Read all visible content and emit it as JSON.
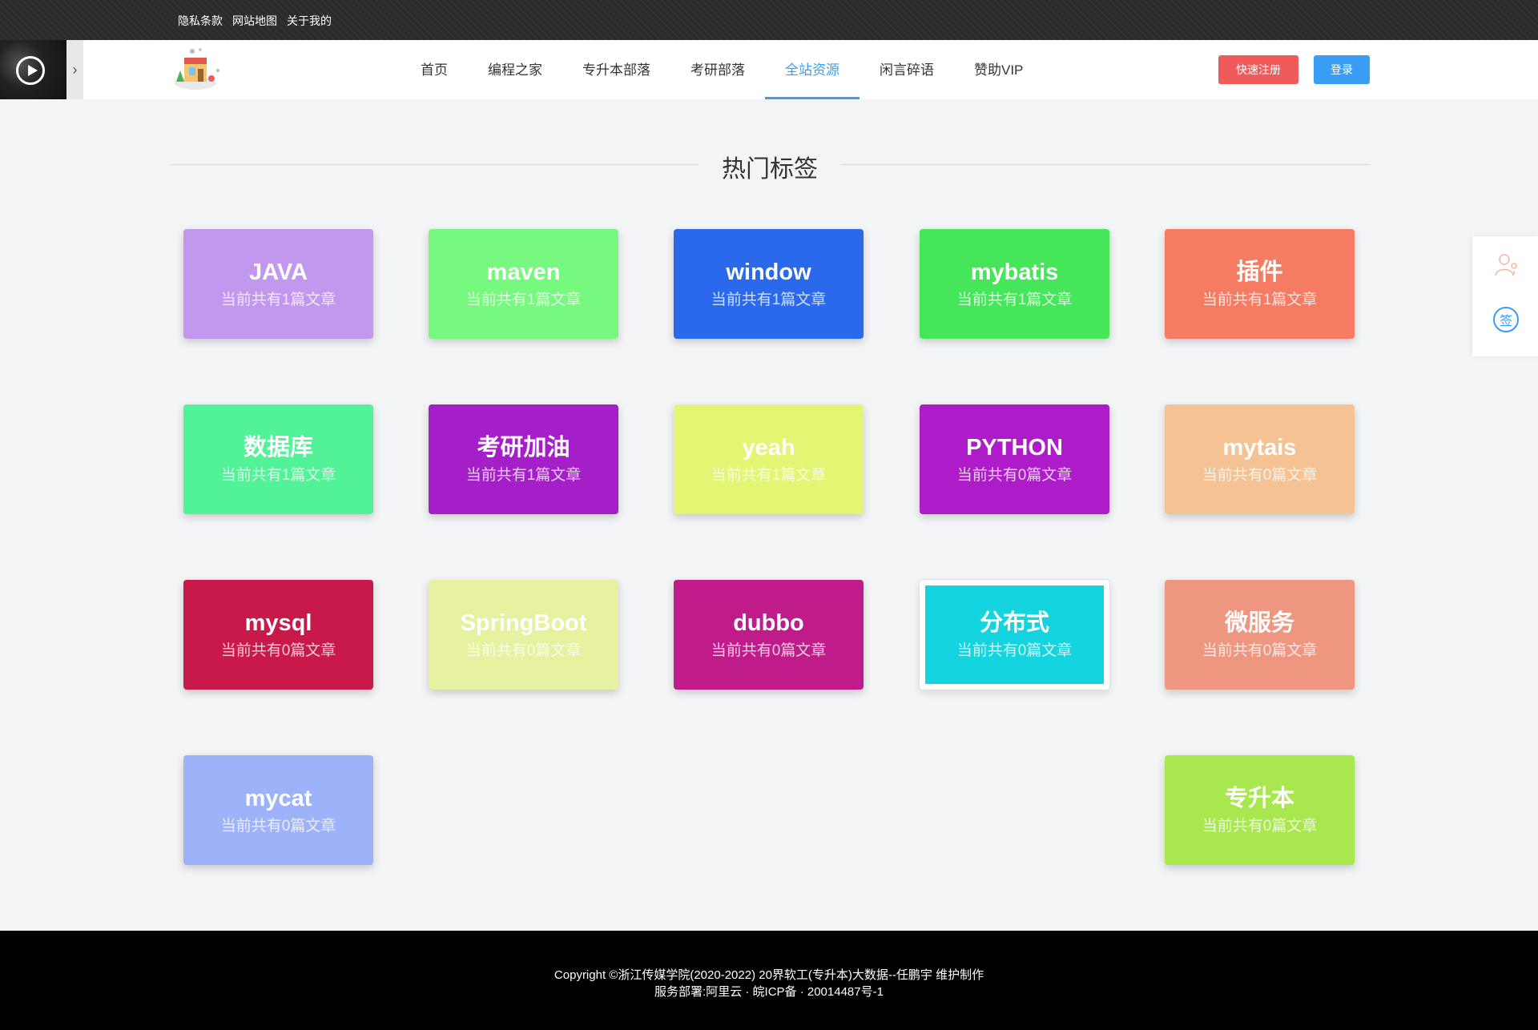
{
  "topbar": {
    "links": [
      "隐私条款",
      "网站地图",
      "关于我的"
    ]
  },
  "nav": {
    "items": [
      {
        "label": "首页",
        "active": false
      },
      {
        "label": "编程之家",
        "active": false
      },
      {
        "label": "专升本部落",
        "active": false
      },
      {
        "label": "考研部落",
        "active": false
      },
      {
        "label": "全站资源",
        "active": true
      },
      {
        "label": "闲言碎语",
        "active": false
      },
      {
        "label": "赞助VIP",
        "active": false
      }
    ],
    "register_label": "快速注册",
    "login_label": "登录",
    "music_toggle_glyph": "›"
  },
  "section": {
    "title": "热门标签"
  },
  "tags": [
    {
      "name": "JAVA",
      "count": "当前共有1篇文章",
      "color": "#c297ee"
    },
    {
      "name": "maven",
      "count": "当前共有1篇文章",
      "color": "#77f980"
    },
    {
      "name": "window",
      "count": "当前共有1篇文章",
      "color": "#2b69ec"
    },
    {
      "name": "mybatis",
      "count": "当前共有1篇文章",
      "color": "#45e65a"
    },
    {
      "name": "插件",
      "count": "当前共有1篇文章",
      "color": "#f57c63"
    },
    {
      "name": "数据库",
      "count": "当前共有1篇文章",
      "color": "#52f299"
    },
    {
      "name": "考研加油",
      "count": "当前共有1篇文章",
      "color": "#a51fc9"
    },
    {
      "name": "yeah",
      "count": "当前共有1篇文章",
      "color": "#e3f572"
    },
    {
      "name": "PYTHON",
      "count": "当前共有0篇文章",
      "color": "#ae1bc8"
    },
    {
      "name": "mytais",
      "count": "当前共有0篇文章",
      "color": "#f5c294"
    },
    {
      "name": "mysql",
      "count": "当前共有0篇文章",
      "color": "#c9184a"
    },
    {
      "name": "SpringBoot",
      "count": "当前共有0篇文章",
      "color": "#e7f19f"
    },
    {
      "name": "dubbo",
      "count": "当前共有0篇文章",
      "color": "#c01b8a"
    },
    {
      "name": "分布式",
      "count": "当前共有0篇文章",
      "color": "#14d4e0",
      "highlight": true
    },
    {
      "name": "微服务",
      "count": "当前共有0篇文章",
      "color": "#ef9681"
    },
    {
      "name": "mycat",
      "count": "当前共有0篇文章",
      "color": "#9eb2f9"
    },
    {
      "name": "专升本",
      "count": "当前共有0篇文章",
      "color": "#a8e84e"
    }
  ],
  "side_widget": {
    "sign_label": "签"
  },
  "footer": {
    "line1": "Copyright ©浙江传媒学院(2020-2022) 20界软工(专升本)大数据--任鹏宇 维护制作",
    "line2": "服务部署:阿里云 · 皖ICP备 · 20014487号-1"
  }
}
